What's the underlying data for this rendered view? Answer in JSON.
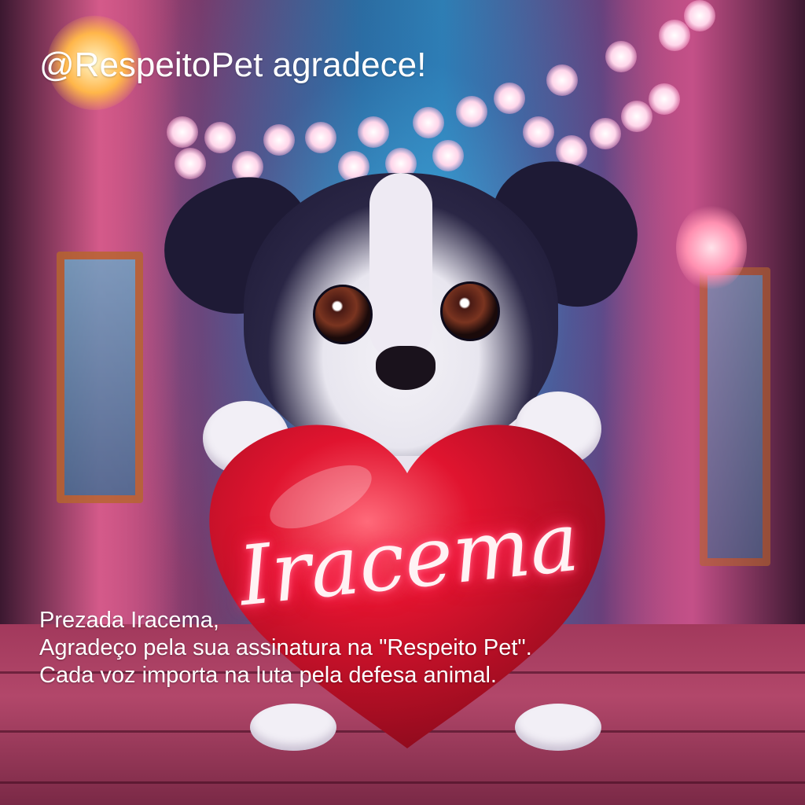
{
  "headline": "@RespeitoPet agradece!",
  "heart_name": "Iracema",
  "message": {
    "greeting": "Prezada Iracema,",
    "line1": "Agradeço pela sua assinatura na \"Respeito Pet\".",
    "line2": "Cada voz importa na luta pela defesa animal."
  },
  "colors": {
    "heart": "#e0142f",
    "neon_text": "#fff2f4",
    "text": "#ffffff"
  }
}
